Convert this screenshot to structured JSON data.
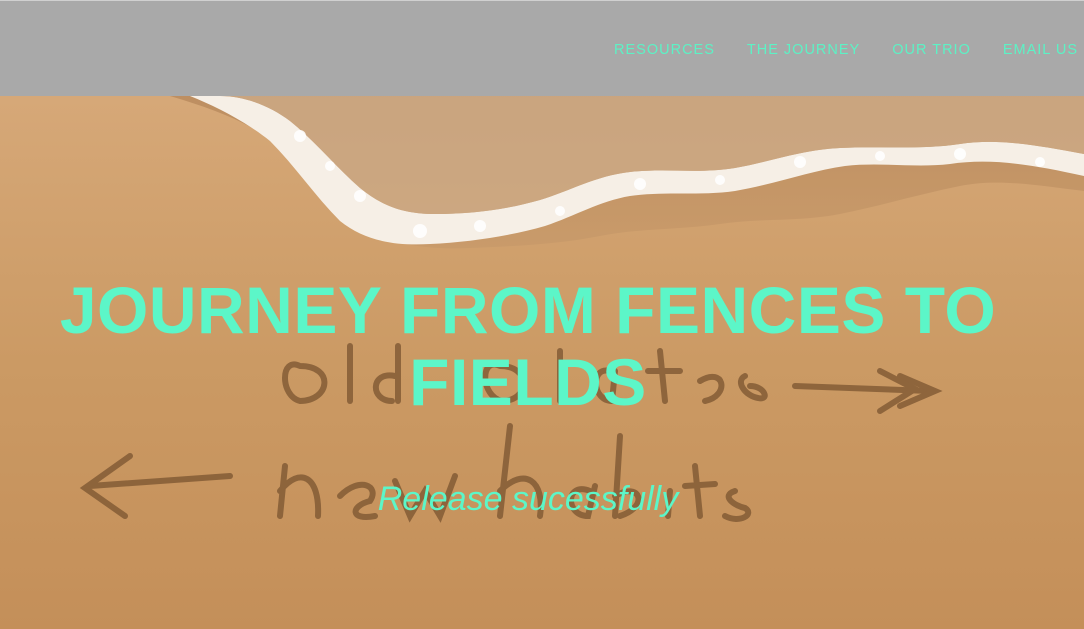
{
  "nav": {
    "items": [
      {
        "label": "RESOURCES"
      },
      {
        "label": "THE JOURNEY"
      },
      {
        "label": "OUR TRIO"
      },
      {
        "label": "EMAIL US"
      }
    ]
  },
  "hero": {
    "title": "JOURNEY FROM FENCES TO FIELDS",
    "subtitle": "Release sucessfully",
    "sand_writing_top": "old habits",
    "sand_writing_bottom": "new habits"
  },
  "colors": {
    "accent": "#5cf6c8",
    "header_bg": "#a9a9a9",
    "sand": "#c8955e"
  }
}
